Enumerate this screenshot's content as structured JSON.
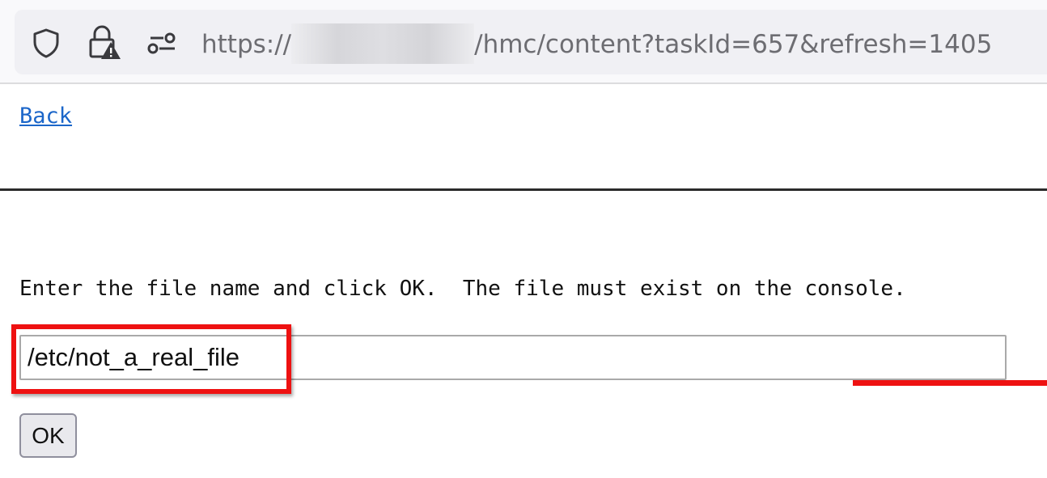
{
  "address_bar": {
    "url_prefix": "https://",
    "url_suffix": "/hmc/content?taskId=657&refresh=1405",
    "icons": [
      "shield-icon",
      "lock-warning-icon",
      "permissions-icon"
    ]
  },
  "page": {
    "back_link": "Back",
    "instructions": "Enter the file name and click OK.  The file must exist on the console.",
    "file_input_value": "/etc/not_a_real_file",
    "ok_label": "OK"
  },
  "colors": {
    "link": "#1b66c9",
    "highlight": "#ee1111"
  }
}
